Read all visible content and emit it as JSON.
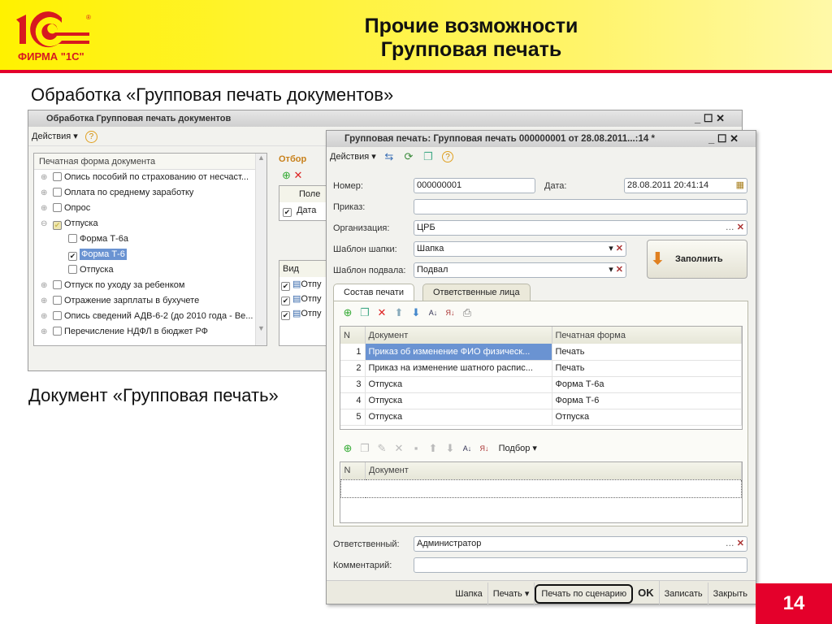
{
  "slide": {
    "title_line1": "Прочие возможности",
    "title_line2": "Групповая печать",
    "subtitle1": "Обработка «Групповая печать документов»",
    "subtitle2": "Документ «Групповая печать»",
    "page_number": "14",
    "logo_text": "ФИРМА \"1С\"",
    "colors": {
      "brand_red": "#e4002b",
      "brand_yellow": "#fff200"
    }
  },
  "back_window": {
    "title": "Обработка  Групповая печать документов",
    "actions": "Действия",
    "tree_header": "Печатная форма документа",
    "tree": [
      {
        "label": "Опись пособий по страхованию от несчаст...",
        "level": 0,
        "checked": false,
        "expander": "plus"
      },
      {
        "label": "Оплата по среднему заработку",
        "level": 0,
        "checked": false,
        "expander": "plus"
      },
      {
        "label": "Опрос",
        "level": 0,
        "checked": false,
        "expander": "plus"
      },
      {
        "label": "Отпуска",
        "level": 0,
        "checked": "partial",
        "expander": "minus"
      },
      {
        "label": "Форма Т-6а",
        "level": 1,
        "checked": false
      },
      {
        "label": "Форма Т-6",
        "level": 1,
        "checked": true,
        "selected": true
      },
      {
        "label": "Отпуска",
        "level": 1,
        "checked": false
      },
      {
        "label": "Отпуск по уходу за ребенком",
        "level": 0,
        "checked": false,
        "expander": "plus"
      },
      {
        "label": "Отражение зарплаты в бухучете",
        "level": 0,
        "checked": false,
        "expander": "plus"
      },
      {
        "label": "Опись сведений АДВ-6-2 (до 2010 года - Ве...",
        "level": 0,
        "checked": false,
        "expander": "plus"
      },
      {
        "label": "Перечисление НДФЛ в бюджет РФ",
        "level": 0,
        "checked": false,
        "expander": "plus"
      }
    ],
    "filter_title": "Отбор",
    "filter_col": "Поле",
    "filter_row": "Дата",
    "view_col": "Вид",
    "view_rows": [
      "Отпу",
      "Отпу",
      "Отпу"
    ]
  },
  "front_window": {
    "title": "Групповая печать: Групповая печать 000000001 от 28.08.2011...:14 *",
    "actions": "Действия",
    "number_label": "Номер:",
    "number_value": "000000001",
    "date_label": "Дата:",
    "date_value": "28.08.2011 20:41:14",
    "order_label": "Приказ:",
    "order_value": "",
    "org_label": "Организация:",
    "org_value": "ЦРБ",
    "header_tpl_label": "Шаблон шапки:",
    "header_tpl_value": "Шапка",
    "footer_tpl_label": "Шаблон подвала:",
    "footer_tpl_value": "Подвал",
    "fill_button": "Заполнить",
    "tabs": [
      "Состав печати",
      "Ответственные лица"
    ],
    "table1": {
      "columns": [
        "N",
        "Документ",
        "Печатная форма"
      ],
      "rows": [
        [
          "1",
          "Приказ об изменение ФИО физическ...",
          "Печать"
        ],
        [
          "2",
          "Приказ на изменение шатного распис...",
          "Печать"
        ],
        [
          "3",
          "Отпуска",
          "Форма Т-6а"
        ],
        [
          "4",
          "Отпуска",
          "Форма Т-6"
        ],
        [
          "5",
          "Отпуска",
          "Отпуска"
        ]
      ]
    },
    "pick_label": "Подбор",
    "table2": {
      "columns": [
        "N",
        "Документ"
      ]
    },
    "responsible_label": "Ответственный:",
    "responsible_value": "Администратор",
    "comment_label": "Комментарий:",
    "comment_value": "",
    "bottom_buttons": {
      "header": "Шапка",
      "print": "Печать",
      "print_scenario": "Печать по сценарию",
      "ok": "OK",
      "save": "Записать",
      "close": "Закрыть"
    }
  }
}
